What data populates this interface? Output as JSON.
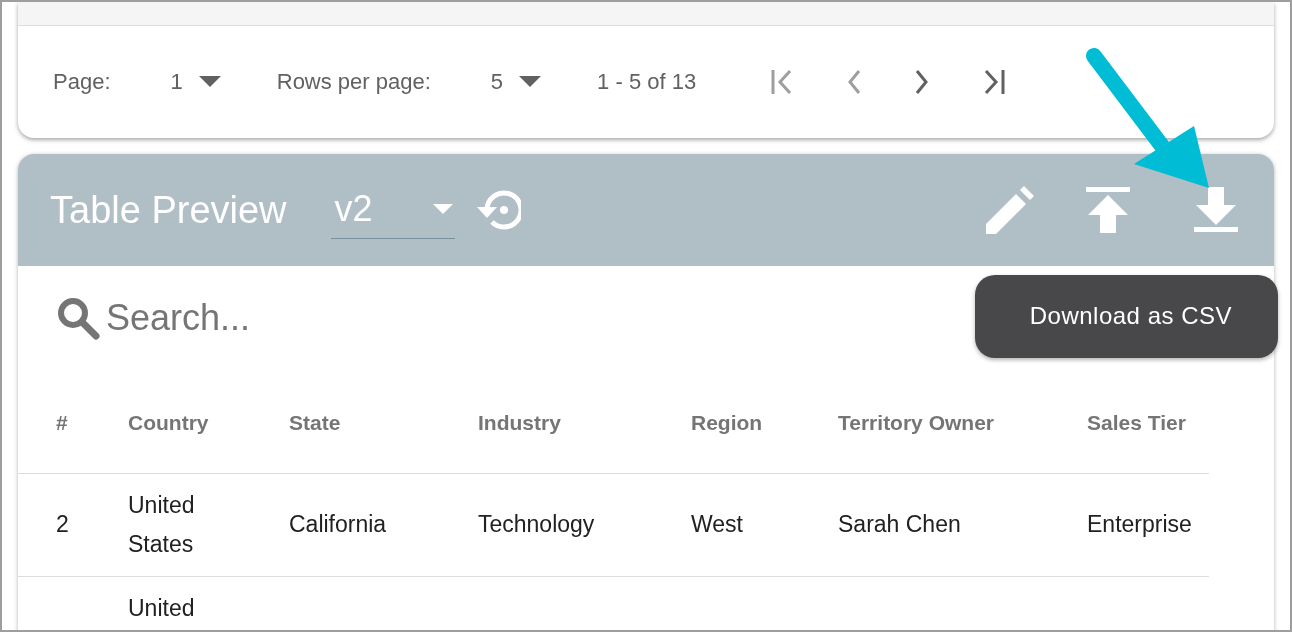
{
  "pagination": {
    "page_label": "Page:",
    "page_value": "1",
    "rows_label": "Rows per page:",
    "rows_value": "5",
    "range": "1 - 5 of 13"
  },
  "preview": {
    "title": "Table Preview",
    "version": "v2",
    "search": {
      "placeholder": "Search..."
    },
    "tooltip": "Download as CSV",
    "columns": [
      "#",
      "Country",
      "State",
      "Industry",
      "Region",
      "Territory Owner",
      "Sales Tier"
    ],
    "rows": [
      [
        "2",
        "United States",
        "California",
        "Technology",
        "West",
        "Sarah Chen",
        "Enterprise"
      ],
      [
        "",
        "United",
        "",
        "",
        "",
        "",
        ""
      ]
    ]
  }
}
